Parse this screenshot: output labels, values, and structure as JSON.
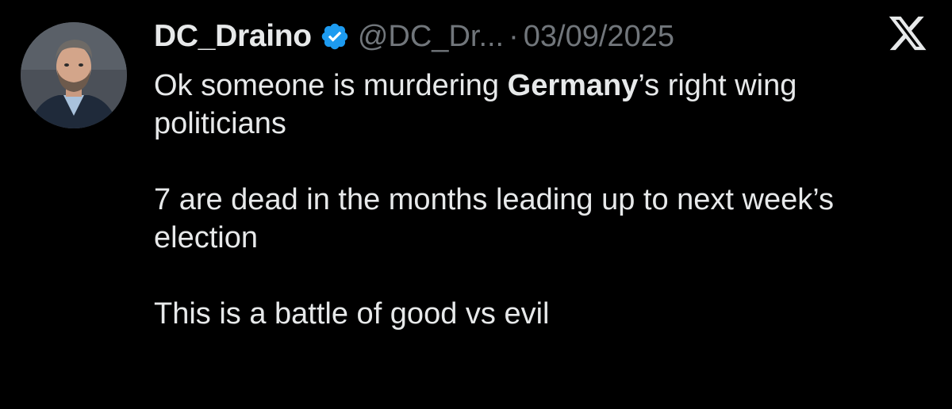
{
  "tweet": {
    "display_name": "DC_Draino",
    "handle": "@DC_Dr...",
    "separator": "·",
    "date": "03/09/2025",
    "verified": true,
    "colors": {
      "background": "#000000",
      "text": "#e7e9ea",
      "muted": "#71767b",
      "verified_badge": "#1d9bf0"
    },
    "icons": {
      "verified": "verified-badge-icon",
      "platform": "x-logo-icon",
      "avatar": "avatar-photo"
    },
    "body": {
      "line1_pre": "Ok someone is murdering ",
      "line1_bold": "Germany",
      "line1_post": "’s right wing politicians",
      "para2": "7 are dead in the months leading up to next week’s election",
      "para3": "This is a battle of good vs evil"
    }
  }
}
